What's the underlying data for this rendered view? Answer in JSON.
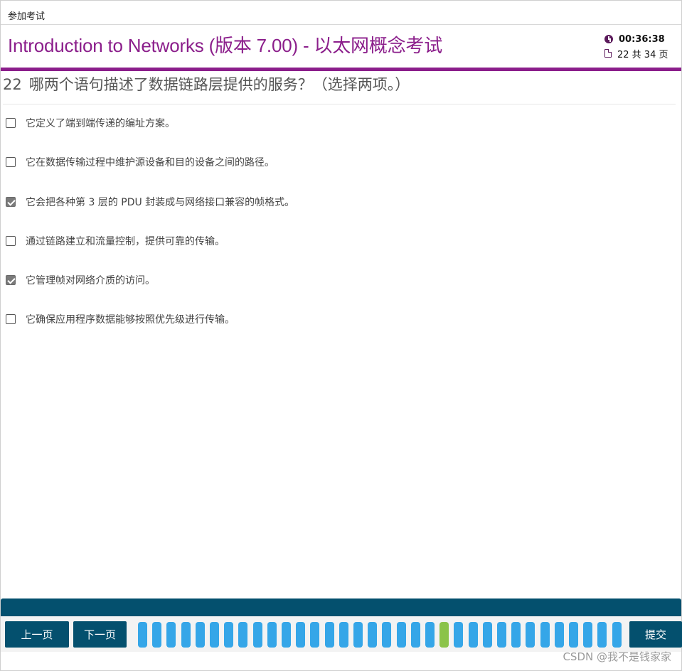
{
  "topbar": {
    "label": "参加考试"
  },
  "header": {
    "title": "Introduction to Networks (版本 7.00) - 以太网概念考试",
    "timer": "00:36:38",
    "page_counter": "22 共 34 页",
    "accent_color": "#8b1e8b"
  },
  "question": {
    "number": "22",
    "text": "哪两个语句描述了数据链路层提供的服务？（选择两项。）"
  },
  "options": [
    {
      "label": "它定义了端到端传递的编址方案。",
      "checked": false
    },
    {
      "label": "它在数据传输过程中维护源设备和目的设备之间的路径。",
      "checked": false
    },
    {
      "label": "它会把各种第 3 层的 PDU 封装成与网络接口兼容的帧格式。",
      "checked": true
    },
    {
      "label": "通过链路建立和流量控制，提供可靠的传输。",
      "checked": false
    },
    {
      "label": "它管理帧对网络介质的访问。",
      "checked": true
    },
    {
      "label": "它确保应用程序数据能够按照优先级进行传输。",
      "checked": false
    }
  ],
  "navigation": {
    "prev_label": "上一页",
    "next_label": "下一页",
    "submit_label": "提交",
    "total_pages": 34,
    "current_page": 22,
    "pill_color": "#35a6e8",
    "current_pill_color": "#8bc34a",
    "bar_color": "#04506e"
  },
  "watermark": "CSDN @我不是钱家家"
}
